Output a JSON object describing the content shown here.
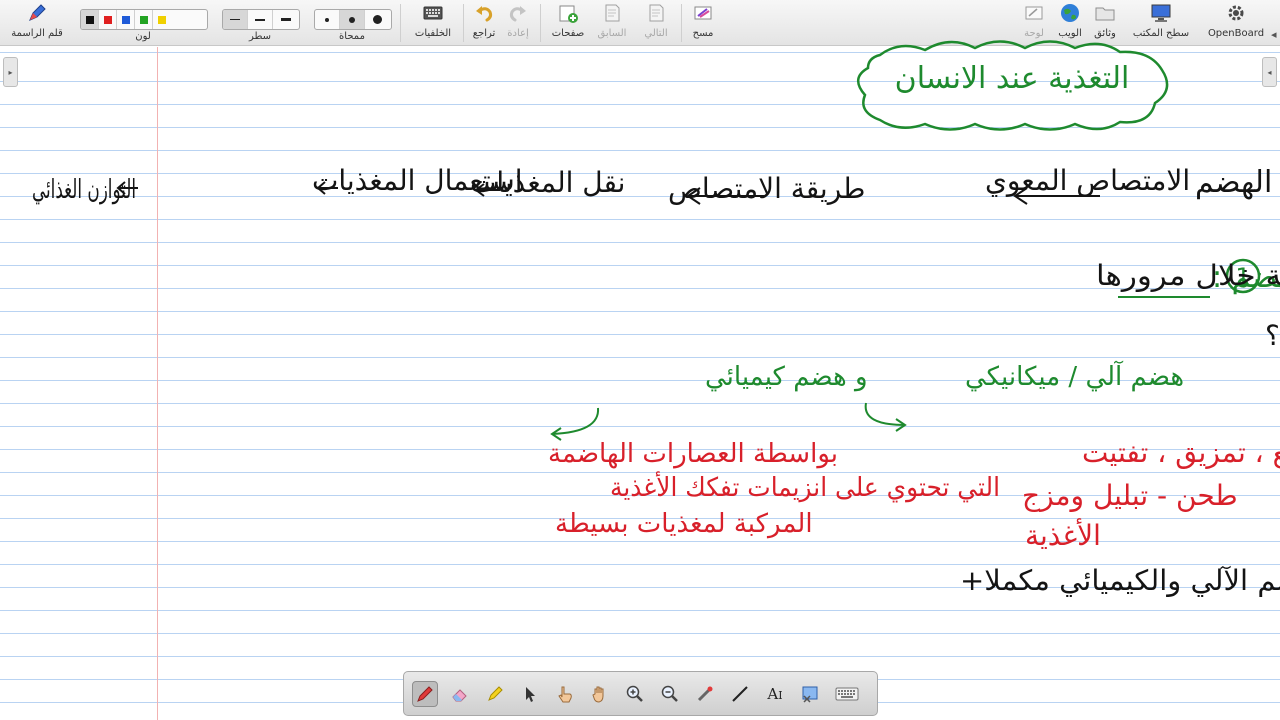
{
  "app": {
    "name": "OpenBoard"
  },
  "toolbar": {
    "right_items": [
      {
        "label": "OpenBoard",
        "icon": "gear-icon"
      },
      {
        "label": "سطح المكتب",
        "icon": "desktop-icon"
      },
      {
        "label": "وثائق",
        "icon": "folder-icon"
      },
      {
        "label": "الويب",
        "icon": "globe-icon"
      },
      {
        "label": "لوحة",
        "icon": "board-icon"
      }
    ],
    "left_items": {
      "pen": "قلم الراسمة",
      "color": "لون",
      "line": "سطر",
      "eraser": "ممحاة",
      "backgrounds": "الخلفيات",
      "undo": "تراجع",
      "redo": "إعادة",
      "pages": "صفحات",
      "previous": "السابق",
      "next": "التالي",
      "clear": "مسح"
    },
    "colors": [
      "#111111",
      "#e02020",
      "#1f5bd8",
      "#23a323",
      "#f0d000"
    ]
  },
  "board": {
    "title": "التغذية عند الانسان",
    "flow": {
      "n1": "الهضم",
      "n2": "الامتصاص المعوي",
      "n3": "طريقة الامتصاص",
      "n4": "نقل المغذيات",
      "n5": "استعمال المغذيات",
      "n6": "التوازن الغذائي"
    },
    "definition": {
      "number": "1",
      "term": "الهضم :",
      "line1": "هو مجموعة من التحولات الآلية والكيميائية التي تطرأ على الأغذية خلال مرورها",
      "line2": "بالأنبوب الهضمي من أجل تحويلها لمغذيات بسيطة قابلة للاستعمال من طرف خلايا العضوية ، وهو نوعان؟"
    },
    "types": {
      "mechanical": "هضم آلي / ميكانيكي",
      "chemical": "و هضم كيميائي"
    },
    "mechanical_details": [
      "تقطيع ، تمزيق ، تفتيت",
      "طحن - تبليل ومزج",
      "الأغذية"
    ],
    "chemical_details": [
      "بواسطة العصارات الهاضمة",
      "التي تحتوي على انزيمات تفكك الأغذية",
      "المركبة لمغذيات بسيطة"
    ],
    "summary": "الهضم الآلي والكيميائي مكملا+"
  },
  "ink_colors": {
    "black": "#141414",
    "green": "#1e8a2e",
    "red": "#d8202a"
  }
}
